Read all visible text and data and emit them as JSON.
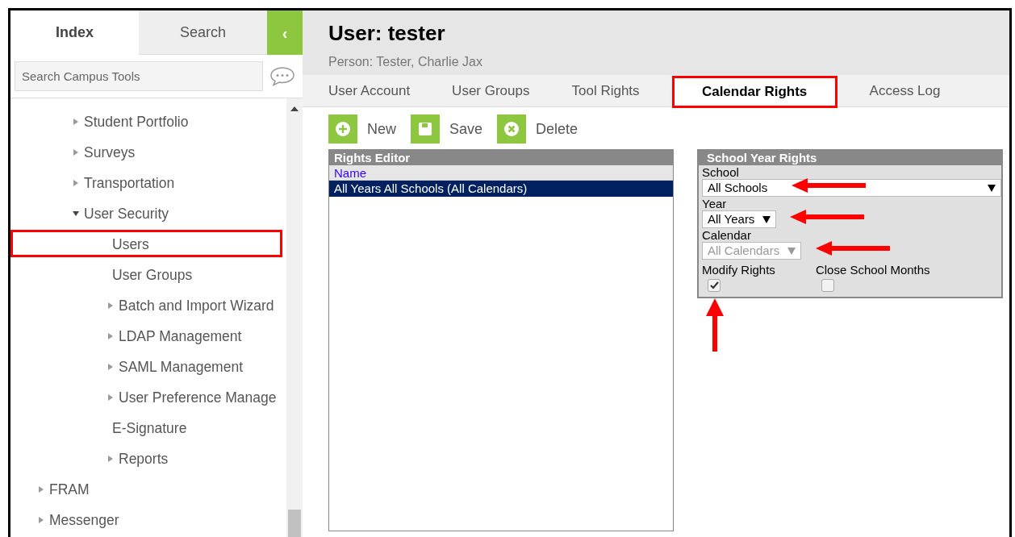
{
  "sidebar": {
    "tabs": [
      {
        "label": "Index",
        "selected": true
      },
      {
        "label": "Search",
        "selected": false
      }
    ],
    "collapse_button": {
      "label": "‹"
    },
    "search": {
      "placeholder": "Search Campus Tools"
    },
    "tree": [
      {
        "children": [
          {
            "label": "Student Portfolio",
            "expanded": false
          },
          {
            "label": "Surveys",
            "expanded": false
          },
          {
            "label": "Transportation",
            "expanded": false
          },
          {
            "label": "User Security",
            "expanded": true,
            "children": [
              {
                "label": "Users",
                "highlighted": true
              },
              {
                "label": "User Groups",
                "highlighted": false
              },
              {
                "label": "Batch and Import Wizard",
                "expanded": false
              },
              {
                "label": "LDAP Management",
                "expanded": false
              },
              {
                "label": "SAML Management",
                "expanded": false
              },
              {
                "label": "User Preference Manage",
                "expanded": false
              },
              {
                "label": "E-Signature",
                "highlighted": false
              },
              {
                "label": "Reports",
                "expanded": false
              }
            ]
          }
        ]
      },
      {
        "label": "FRAM",
        "expanded": false
      },
      {
        "label": "Messenger",
        "expanded": false
      }
    ]
  },
  "header": {
    "title": "User: tester",
    "subtitle": "Person: Tester, Charlie Jax"
  },
  "tabs": [
    {
      "label": "User Account",
      "selected": false,
      "highlighted": false
    },
    {
      "label": "User Groups",
      "selected": false,
      "highlighted": false
    },
    {
      "label": "Tool Rights",
      "selected": false,
      "highlighted": false
    },
    {
      "label": "Calendar Rights",
      "selected": true,
      "highlighted": true
    },
    {
      "label": "Access Log",
      "selected": false,
      "highlighted": false
    }
  ],
  "toolbar": [
    {
      "kind": "new",
      "label": "New"
    },
    {
      "kind": "save",
      "label": "Save"
    },
    {
      "kind": "delete",
      "label": "Delete"
    }
  ],
  "rights_editor": {
    "title": "Rights Editor",
    "column": "Name",
    "rows": [
      {
        "label": "All Years All Schools (All Calendars)",
        "selected": true
      }
    ]
  },
  "school_year_rights": {
    "title": "School Year Rights",
    "selects": [
      {
        "label": "School",
        "value": "All Schools",
        "disabled": false,
        "wide": true,
        "arrow": true
      },
      {
        "label": "Year",
        "value": "All Years",
        "disabled": false,
        "wide": false,
        "arrow": true
      },
      {
        "label": "Calendar",
        "value": "All Calendars",
        "disabled": true,
        "wide": false,
        "arrow": true
      }
    ],
    "checkboxes": [
      {
        "label": "Modify Rights",
        "checked": true,
        "arrow": true
      },
      {
        "label": "Close School Months",
        "checked": false,
        "arrow": false
      }
    ]
  }
}
